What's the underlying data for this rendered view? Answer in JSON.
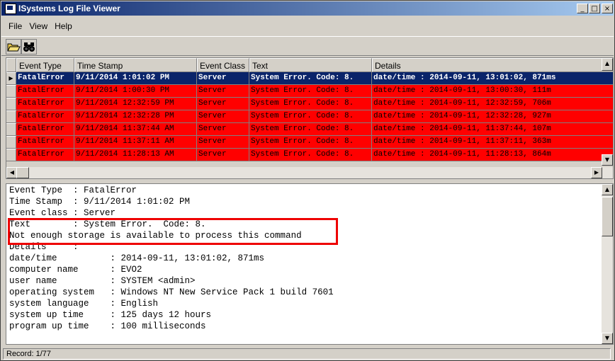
{
  "window": {
    "title": "ISystems Log File Viewer"
  },
  "menu": [
    "File",
    "View",
    "Help"
  ],
  "toolbar": {
    "open_icon": "folder-open-icon",
    "find_icon": "binoculars-icon"
  },
  "grid": {
    "columns": [
      "Event Type",
      "Time Stamp",
      "Event Class",
      "Text",
      "Details"
    ],
    "rows": [
      [
        "FatalError",
        "9/11/2014 1:01:02 PM",
        "Server",
        "System Error.  Code: 8.",
        "date/time           : 2014-09-11, 13:01:02, 871ms"
      ],
      [
        "FatalError",
        "9/11/2014 1:00:30 PM",
        "Server",
        "System Error.  Code: 8.",
        "date/time           : 2014-09-11, 13:00:30, 111m"
      ],
      [
        "FatalError",
        "9/11/2014 12:32:59 PM",
        "Server",
        "System Error.  Code: 8.",
        "date/time           : 2014-09-11, 12:32:59, 706m"
      ],
      [
        "FatalError",
        "9/11/2014 12:32:28 PM",
        "Server",
        "System Error.  Code: 8.",
        "date/time           : 2014-09-11, 12:32:28, 927m"
      ],
      [
        "FatalError",
        "9/11/2014 11:37:44 AM",
        "Server",
        "System Error.  Code: 8.",
        "date/time           : 2014-09-11, 11:37:44, 107m"
      ],
      [
        "FatalError",
        "9/11/2014 11:37:11 AM",
        "Server",
        "System Error.  Code: 8.",
        "date/time           : 2014-09-11, 11:37:11, 363m"
      ],
      [
        "FatalError",
        "9/11/2014 11:28:13 AM",
        "Server",
        "System Error.  Code: 8.",
        "date/time           : 2014-09-11, 11:28:13, 864m"
      ]
    ]
  },
  "detail": {
    "lines": [
      "Event Type  : FatalError",
      "Time Stamp  : 9/11/2014 1:01:02 PM",
      "Event class : Server",
      "Text        : System Error.  Code: 8.",
      "Not enough storage is available to process this command",
      "Details     :",
      "date/time          : 2014-09-11, 13:01:02, 871ms",
      "computer name      : EVO2",
      "user name          : SYSTEM <admin>",
      "operating system   : Windows NT New Service Pack 1 build 7601",
      "system language    : English",
      "system up time     : 125 days 12 hours",
      "program up time    : 100 milliseconds"
    ]
  },
  "status": {
    "record": "Record: 1/77"
  },
  "colors": {
    "error_row": "#ff0000",
    "selected_row": "#0a246a",
    "highlight_box": "#e00000"
  }
}
